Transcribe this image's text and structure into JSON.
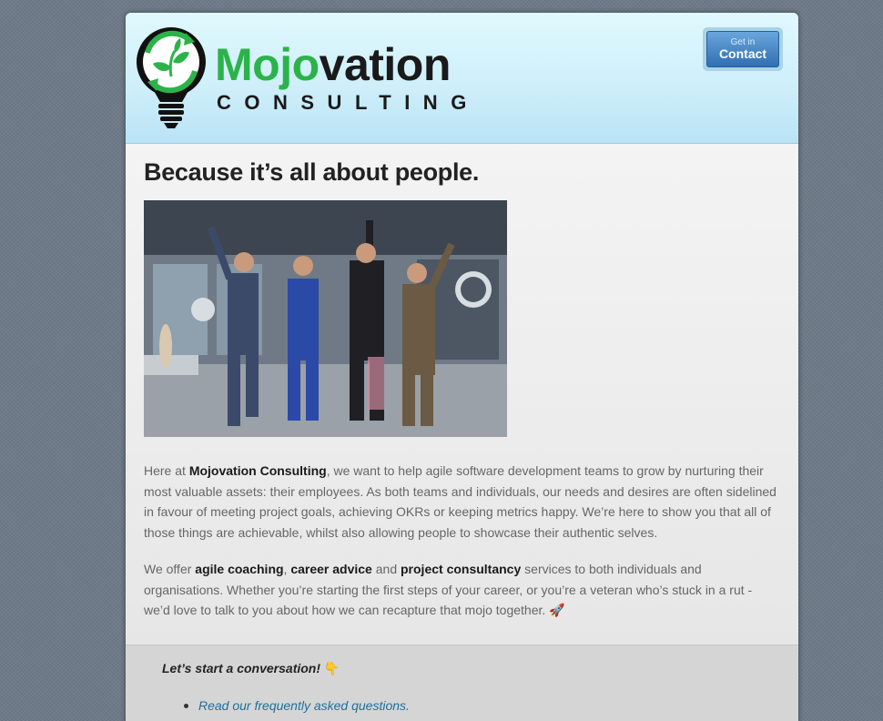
{
  "header": {
    "logo": {
      "word_a": "Mojo",
      "word_b": "vation",
      "subtitle": "CONSULTING",
      "icon": "lightbulb-leaf-icon"
    },
    "contact_button": {
      "small": "Get in",
      "big": "Contact"
    }
  },
  "main": {
    "headline": "Because it’s all about people.",
    "image_alt": "animated gif of four men in suits jumping and celebrating",
    "para1": {
      "t1": "Here at ",
      "b1": "Mojovation Consulting",
      "t2": ", we want to help agile software development teams to grow by nurturing their most valuable assets: their employees. As both teams and individuals, our needs and desires are often sidelined in favour of meeting project goals, achieving OKRs or keeping metrics happy. We’re here to show you that all of those things are achievable, whilst also allowing people to showcase their authentic selves."
    },
    "para2": {
      "t1": "We offer ",
      "b1": "agile coaching",
      "t2": ", ",
      "b2": "career advice",
      "t3": " and ",
      "b3": "project consultancy",
      "t4": " services to both individuals and organisations. Whether you’re starting the first steps of your career, or you’re a veteran who’s stuck in a rut - we’d love to talk to you about how we can recapture that mojo together. ",
      "emoji": "🚀"
    }
  },
  "footer": {
    "heading": "Let’s start a conversation!",
    "heading_emoji": "👇",
    "links": [
      "Read our frequently asked questions."
    ]
  },
  "colors": {
    "brand_green": "#2bb34a",
    "button_blue": "#2f6fb2",
    "link": "#1f6f9a"
  }
}
